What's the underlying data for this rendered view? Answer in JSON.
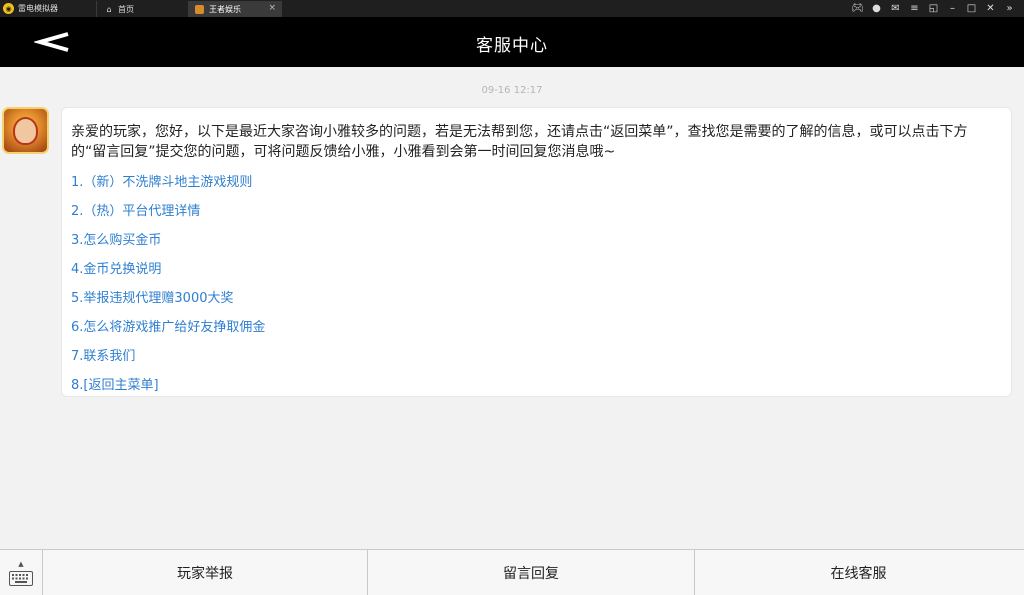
{
  "emulator": {
    "app_name": "雷电模拟器",
    "tabs": [
      {
        "label": "首页",
        "icon": "home-icon"
      },
      {
        "label": "王者娱乐",
        "icon": "game-icon"
      }
    ],
    "controls": [
      "gamepad-icon",
      "user-icon",
      "mail-icon",
      "menu-icon",
      "restore-icon",
      "minimize-icon",
      "maximize-icon",
      "close-icon",
      "collapse-icon"
    ]
  },
  "header": {
    "title": "客服中心",
    "back_icon": "back-arrow-icon"
  },
  "chat": {
    "timestamp": "09-16 12:17",
    "message": "亲爱的玩家，您好，以下是最近大家咨询小雅较多的问题，若是无法帮到您，还请点击“返回菜单”，查找您是需要的了解的信息，或可以点击下方的“留言回复”提交您的问题，可将问题反馈给小雅，小雅看到会第一时间回复您消息哦~",
    "faq": [
      "1.（新）不洗牌斗地主游戏规则",
      "2.（热）平台代理详情",
      "3.怎么购买金币",
      "4.金币兑换说明",
      "5.举报违规代理赠3000大奖",
      "6.怎么将游戏推广给好友挣取佣金",
      "7.联系我们",
      "8.[返回主菜单]"
    ]
  },
  "bottom_menu": {
    "buttons": [
      "玩家举报",
      "留言回复",
      "在线客服"
    ]
  },
  "colors": {
    "link": "#2f7fd1",
    "header_bg": "#000000",
    "titlebar_bg": "#1f1f1f"
  }
}
